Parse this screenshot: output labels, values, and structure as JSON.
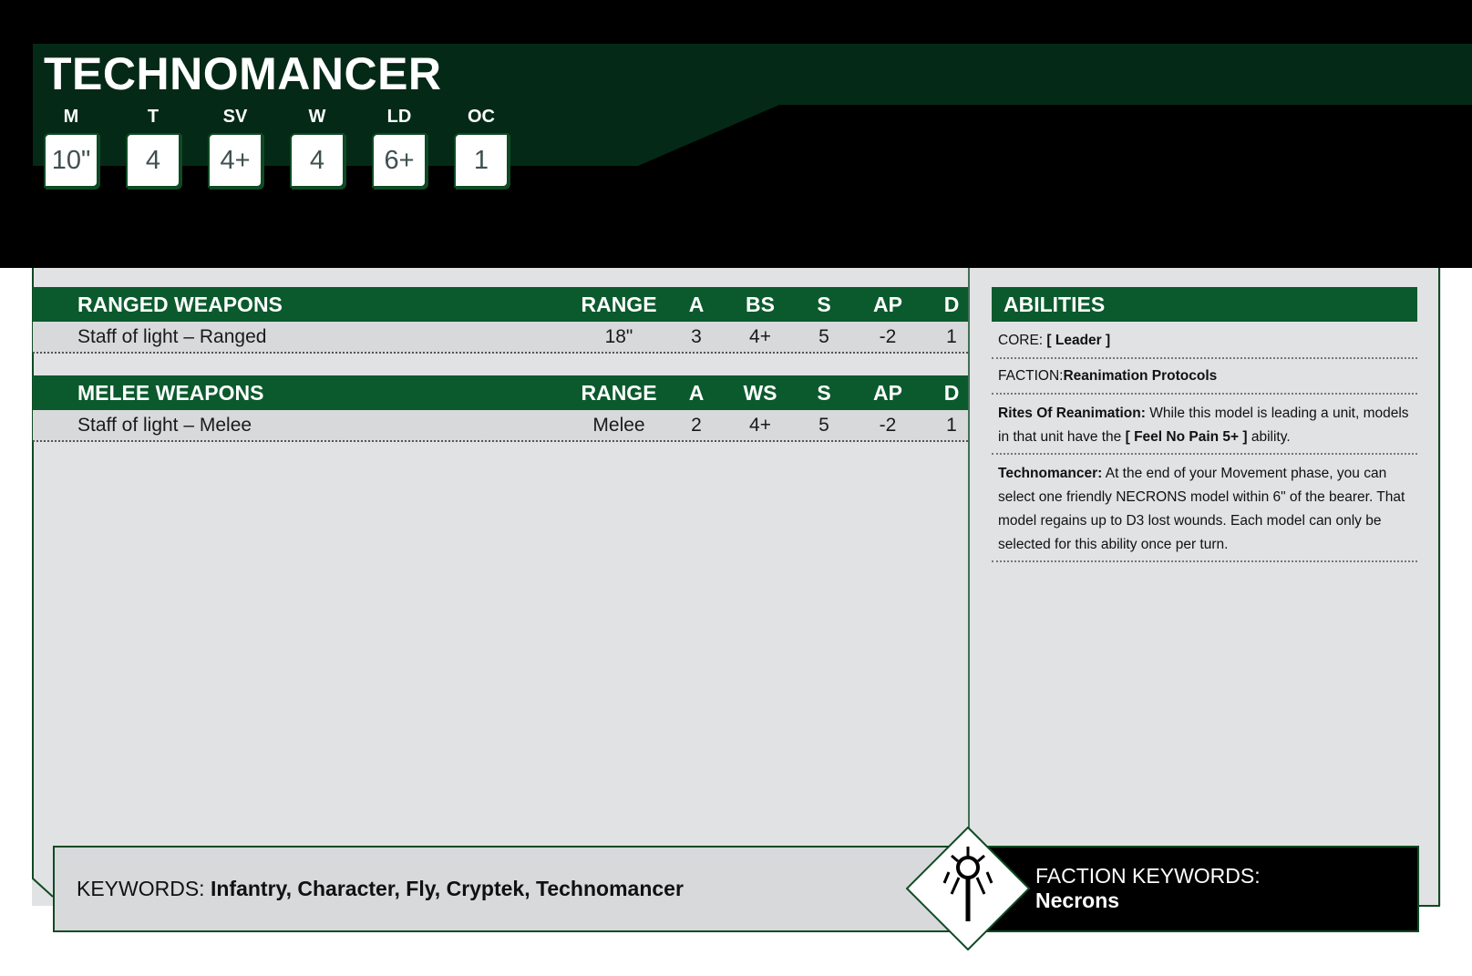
{
  "unit": {
    "name": "TECHNOMANCER",
    "stats": [
      {
        "label": "M",
        "value": "10\""
      },
      {
        "label": "T",
        "value": "4"
      },
      {
        "label": "SV",
        "value": "4+"
      },
      {
        "label": "W",
        "value": "4"
      },
      {
        "label": "LD",
        "value": "6+"
      },
      {
        "label": "OC",
        "value": "1"
      }
    ]
  },
  "ranged": {
    "header": {
      "name": "RANGED WEAPONS",
      "range": "RANGE",
      "a": "A",
      "skill": "BS",
      "s": "S",
      "ap": "AP",
      "d": "D"
    },
    "rows": [
      {
        "name": "Staff of light – Ranged",
        "range": "18\"",
        "a": "3",
        "skill": "4+",
        "s": "5",
        "ap": "-2",
        "d": "1"
      }
    ]
  },
  "melee": {
    "header": {
      "name": "MELEE WEAPONS",
      "range": "RANGE",
      "a": "A",
      "skill": "WS",
      "s": "S",
      "ap": "AP",
      "d": "D"
    },
    "rows": [
      {
        "name": "Staff of light – Melee",
        "range": "Melee",
        "a": "2",
        "skill": "4+",
        "s": "5",
        "ap": "-2",
        "d": "1"
      }
    ]
  },
  "abilities": {
    "header": "ABILITIES",
    "core_label": "CORE:",
    "core_value": "[ Leader ]",
    "faction_label": "FACTION:",
    "faction_value": "Reanimation Protocols",
    "rites_name": "Rites Of Reanimation:",
    "rites_text_1": " While this model is leading a unit, models in that unit have the ",
    "rites_keyword": "[ Feel No Pain 5+ ]",
    "rites_text_2": " ability.",
    "techno_name": "Technomancer:",
    "techno_text": " At the end of your Movement phase, you can select one friendly NECRONS model within 6\" of the bearer. That model regains up to D3 lost wounds. Each model can only be selected for this ability once per turn."
  },
  "keywords": {
    "label": "KEYWORDS: ",
    "value": "Infantry, Character, Fly, Cryptek, Technomancer"
  },
  "faction_keywords": {
    "label": "FACTION KEYWORDS:",
    "value": "Necrons",
    "icon": "necron-glyph-icon"
  },
  "colors": {
    "header_green": "#042a17",
    "band_green": "#0b5a2d",
    "panel_grey": "#e1e2e4",
    "frame_green": "#0f4a24"
  }
}
